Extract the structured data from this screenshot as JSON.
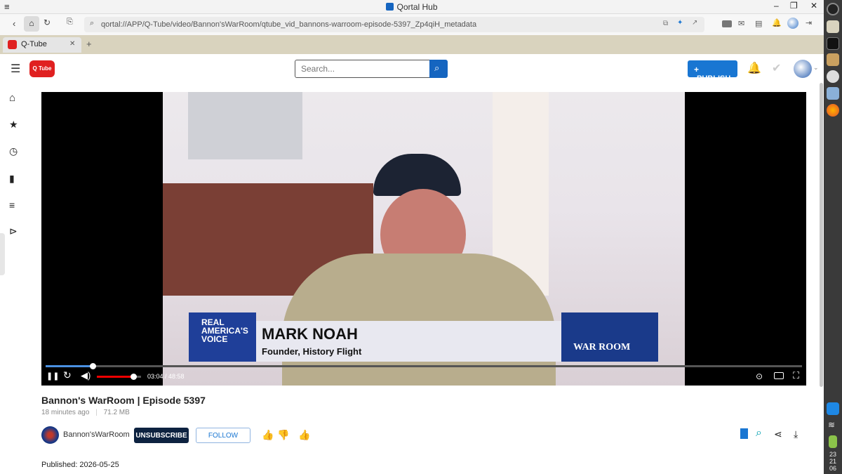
{
  "window": {
    "title": "Qortal Hub"
  },
  "browser": {
    "url": "qortal://APP/Q-Tube/video/Bannon'sWarRoom/qtube_vid_bannons-warroom-episode-5397_Zp4qiH_metadata",
    "tab_label": "Q-Tube",
    "new_tab": "+"
  },
  "header": {
    "logo_text": "Q Tube",
    "search_placeholder": "Search...",
    "publish_label": "PUBLISH"
  },
  "video": {
    "overlay": {
      "network_line1": "REAL",
      "network_line2": "AMERICA'S",
      "network_line3": "VOICE",
      "name": "MARK NOAH",
      "role": "Founder, History Flight",
      "brand": "WAR ROOM"
    },
    "time_display": "03:04 / 48:58",
    "progress": 0.062,
    "volume": 0.82
  },
  "details": {
    "title": "Bannon's WarRoom | Episode 5397",
    "age": "18 minutes ago",
    "size": "71.2 MB",
    "channel": "Bannon'sWarRoom",
    "unsubscribe": "UNSUBSCRIBE",
    "follow": "FOLLOW",
    "published": "Published: 2026-05-25"
  },
  "clock": [
    "23",
    "21",
    "06"
  ],
  "colors": {
    "accent": "#1976d2",
    "dark_button": "#0d2240",
    "dock": "#3a3a3a",
    "tab_strip": "#d9d3be"
  }
}
